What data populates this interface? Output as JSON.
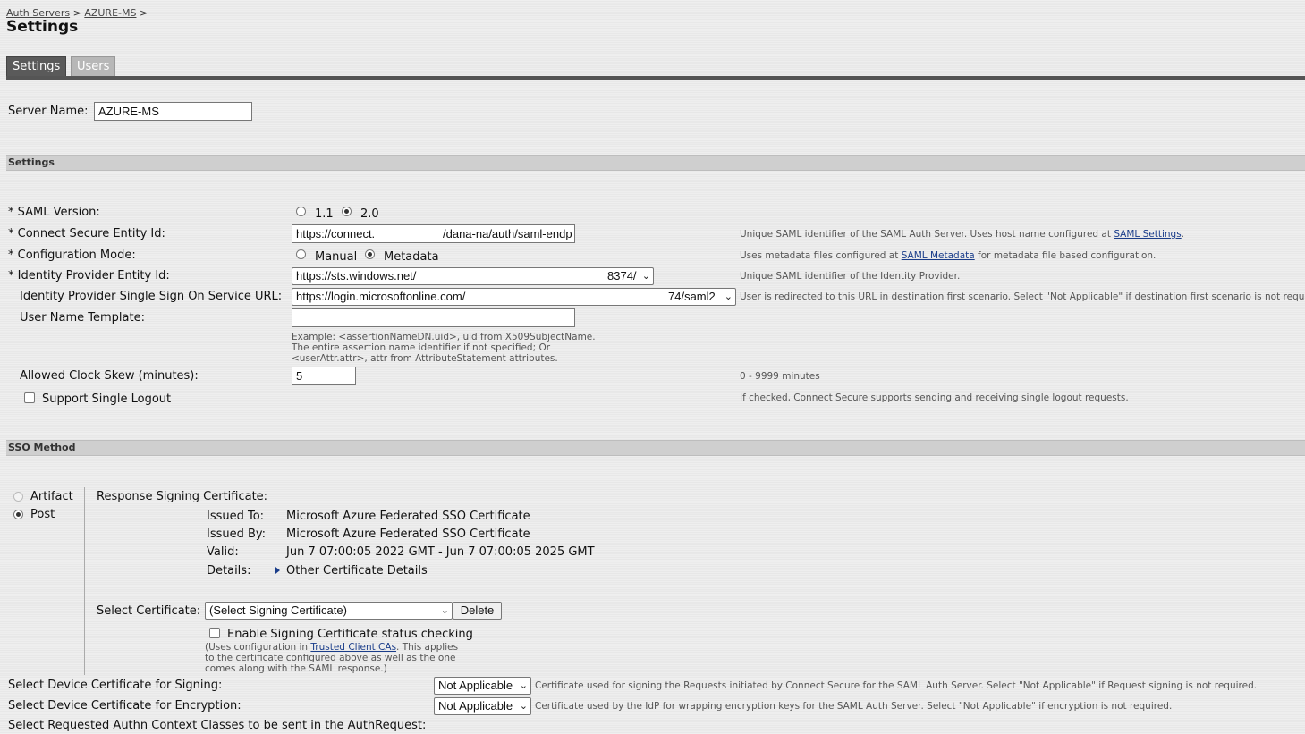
{
  "breadcrumb": {
    "item1": "Auth Servers",
    "sep1": ">",
    "item2": "AZURE-MS",
    "sep2": ">"
  },
  "page_title": "Settings",
  "tabs": [
    {
      "label": "Settings",
      "active": true
    },
    {
      "label": "Users",
      "active": false
    }
  ],
  "server_name": {
    "label": "Server Name:",
    "value": "AZURE-MS"
  },
  "sections": {
    "settings": "Settings",
    "sso": "SSO Method"
  },
  "saml_version": {
    "label": "* SAML Version:",
    "opt1": "1.1",
    "opt2": "2.0",
    "selected": "2.0"
  },
  "entity_id": {
    "label": "* Connect Secure Entity Id:",
    "value_start": "https://connect.",
    "value_end": "/dana-na/auth/saml-endp",
    "hint": "Unique SAML identifier of the SAML Auth Server. Uses host name configured at ",
    "hint_link": "SAML Settings",
    "hint_end": "."
  },
  "config_mode": {
    "label": "* Configuration Mode:",
    "opt1": "Manual",
    "opt2": "Metadata",
    "selected": "Metadata",
    "hint": "Uses metadata files configured at ",
    "hint_link": "SAML Metadata",
    "hint_end": " for metadata file based configuration."
  },
  "idp_entity": {
    "label": "* Identity Provider Entity Id:",
    "value_start": "https://sts.windows.net/",
    "value_end": "8374/",
    "hint": "Unique SAML identifier of the Identity Provider."
  },
  "idp_sso_url": {
    "label": "Identity Provider Single Sign On Service URL:",
    "value_start": "https://login.microsoftonline.com/",
    "value_end": "74/saml2",
    "hint": "User is redirected to this URL in destination first scenario. Select \"Not Applicable\" if destination first scenario is not required."
  },
  "username_template": {
    "label": "User Name Template:",
    "value": "",
    "example1": "Example: <assertionNameDN.uid>, uid from X509SubjectName.",
    "example2": "The entire assertion name identifier if not specified; Or",
    "example3": "<userAttr.attr>, attr from AttributeStatement attributes."
  },
  "clock_skew": {
    "label": "Allowed Clock Skew (minutes):",
    "value": "5",
    "hint": "0 - 9999 minutes"
  },
  "single_logout": {
    "label": "Support Single Logout",
    "checked": false,
    "hint": "If checked, Connect Secure supports sending and receiving single logout requests."
  },
  "sso_method": {
    "opt1": "Artifact",
    "opt2": "Post",
    "selected": "Post"
  },
  "cert": {
    "heading": "Response Signing Certificate:",
    "issued_to_label": "Issued To:",
    "issued_to": "Microsoft Azure Federated SSO Certificate",
    "issued_by_label": "Issued By:",
    "issued_by": "Microsoft Azure Federated SSO Certificate",
    "valid_label": "Valid:",
    "valid": "Jun 7 07:00:05 2022 GMT - Jun 7 07:00:05 2025 GMT",
    "details_label": "Details:",
    "details_link": "Other Certificate Details",
    "select_label": "Select Certificate:",
    "select_value": "(Select Signing Certificate)",
    "delete_button": "Delete",
    "status_check_label": "Enable Signing Certificate status checking",
    "note1": "(Uses configuration in ",
    "note_link": "Trusted Client CAs",
    "note1_end": ". This applies",
    "note2": "to the certificate configured above as well as the one",
    "note3": "comes along with the SAML response.)"
  },
  "device_signing": {
    "label": "Select Device Certificate for Signing:",
    "value": "Not Applicable",
    "hint": "Certificate used for signing the Requests initiated by Connect Secure for the SAML Auth Server. Select \"Not Applicable\" if Request signing is not required."
  },
  "device_encryption": {
    "label": "Select Device Certificate for Encryption:",
    "value": "Not Applicable",
    "hint": "Certificate used by the IdP for wrapping encryption keys for the SAML Auth Server. Select \"Not Applicable\" if encryption is not required."
  },
  "authn_context": {
    "label": "Select Requested Authn Context Classes to be sent in the AuthRequest:"
  }
}
